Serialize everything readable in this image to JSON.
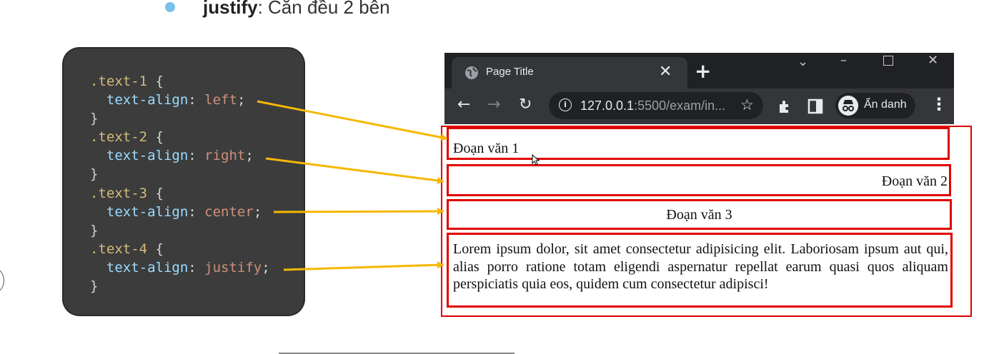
{
  "heading": {
    "keyword": "justify",
    "text": ": Căn đều 2 bên"
  },
  "code": {
    "lines": [
      {
        "selector": ".text-1",
        "property": "text-align",
        "value": "left"
      },
      {
        "selector": ".text-2",
        "property": "text-align",
        "value": "right"
      },
      {
        "selector": ".text-3",
        "property": "text-align",
        "value": "center"
      },
      {
        "selector": ".text-4",
        "property": "text-align",
        "value": "justify"
      }
    ]
  },
  "browser": {
    "tab_title": "Page Title",
    "url_host": "127.0.0.1",
    "url_rest": ":5500/exam/in...",
    "incognito_label": "Ẩn danh"
  },
  "page": {
    "p1": "Đoạn văn 1",
    "p2": "Đoạn văn 2",
    "p3": "Đoạn văn 3",
    "p4": "Lorem ipsum dolor, sit amet consectetur adipisicing elit. Laboriosam ipsum aut qui, alias porro ratione totam eligendi aspernatur repellat earum quasi quos aliquam perspiciatis quia eos, quidem cum consectetur adipisci!"
  },
  "colors": {
    "arrow": "#f5b800",
    "box_border": "#e00000",
    "bullet": "#7bbfea"
  },
  "icons": [
    "globe-icon",
    "close-icon",
    "plus-icon",
    "back-icon",
    "forward-icon",
    "reload-icon",
    "info-icon",
    "star-icon",
    "extensions-icon",
    "sidepanel-icon",
    "incognito-icon",
    "kebab-icon"
  ]
}
